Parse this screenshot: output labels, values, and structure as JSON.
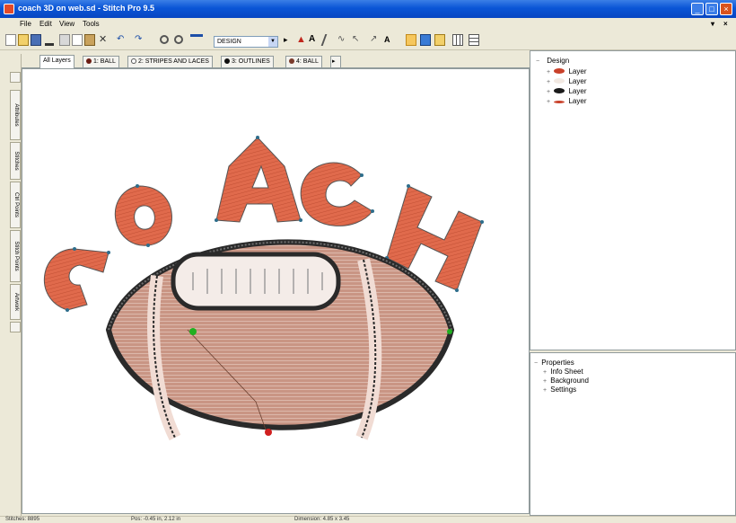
{
  "window": {
    "title": "coach 3D on web.sd - Stitch Pro 9.5"
  },
  "menu": [
    "File",
    "Edit",
    "View",
    "Tools"
  ],
  "toolbar": {
    "zoom_value": "DESIGN"
  },
  "tabs": [
    {
      "label": "All Layers",
      "active": true,
      "dot": ""
    },
    {
      "label": "1: BALL",
      "dot": "#6b1c12"
    },
    {
      "label": "2: STRIPES AND LACES",
      "dot": "#ffffff"
    },
    {
      "label": "3: OUTLINES",
      "dot": "#111111"
    },
    {
      "label": "4: BALL",
      "dot": "#7a3b2b"
    }
  ],
  "side_tabs": [
    "Attributes",
    "Stitches",
    "Ctrl Points",
    "Stitch Points",
    "Artwork"
  ],
  "design_tree": {
    "root": "Design",
    "layers": [
      {
        "label": "Layer",
        "color": "#c9412a"
      },
      {
        "label": "Layer",
        "color": "#f2e9e2"
      },
      {
        "label": "Layer",
        "color": "#1b1b1b"
      },
      {
        "label": "Layer",
        "color": "#c9412a"
      }
    ]
  },
  "properties": {
    "root": "Properties",
    "items": [
      "Info Sheet",
      "Background",
      "Settings"
    ]
  },
  "canvas_art": {
    "text": "COACH"
  },
  "status": {
    "left": "Stitches: 8895",
    "middle": "Pos: -0.45 in, 2.12 in",
    "right": "Dimension: 4.85 x 3.45"
  },
  "colors": {
    "accent": "#0a55d6",
    "stitch_orange": "#e06a4c",
    "ball_brown": "#c89a86",
    "outline": "#2a2a2a"
  }
}
